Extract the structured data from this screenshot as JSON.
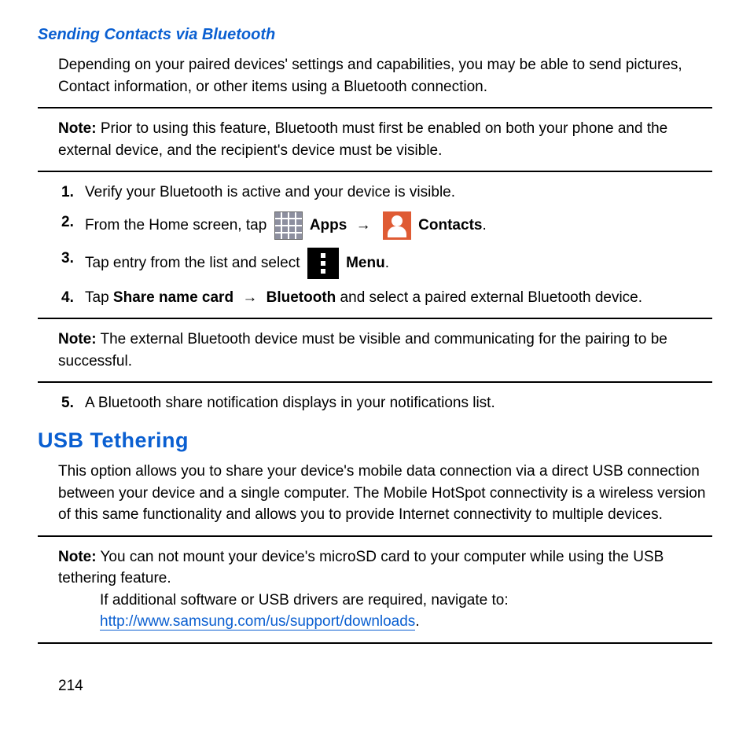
{
  "section1": {
    "title": "Sending Contacts via Bluetooth",
    "intro": "Depending on your paired devices' settings and capabilities, you may be able to send pictures, Contact information, or other items using a Bluetooth connection."
  },
  "note1": {
    "label": "Note:",
    "text": "Prior to using this feature, Bluetooth must first be enabled on both your phone and the external device, and the recipient's device must be visible."
  },
  "steps": {
    "s1": "Verify your Bluetooth is active and your device is visible.",
    "s2_pre": "From the Home screen, tap",
    "s2_apps": "Apps",
    "s2_contacts": "Contacts",
    "s3_pre": "Tap entry from the list and select",
    "s3_menu": "Menu",
    "s4_pre": "Tap ",
    "s4_b1": "Share name card",
    "s4_b2": "Bluetooth",
    "s4_post": " and select a paired external Bluetooth device.",
    "s5": "A Bluetooth share notification displays in your notifications list."
  },
  "note2": {
    "label": "Note:",
    "text": "The external Bluetooth device must be visible and communicating for the pairing to be successful."
  },
  "section2": {
    "title": "USB Tethering",
    "intro": "This option allows you to share your device's mobile data connection via a direct USB connection between your device and a single computer. The Mobile HotSpot connectivity is a wireless version of this same functionality and allows you to provide Internet connectivity to multiple devices."
  },
  "note3": {
    "label": "Note:",
    "line1": "You can not mount your device's microSD card to your computer while using the USB tethering feature.",
    "line2_pre": "If additional software or USB drivers are required, navigate to: ",
    "link": "http://www.samsung.com/us/support/downloads"
  },
  "arrow": "→",
  "period": ".",
  "page": "214"
}
